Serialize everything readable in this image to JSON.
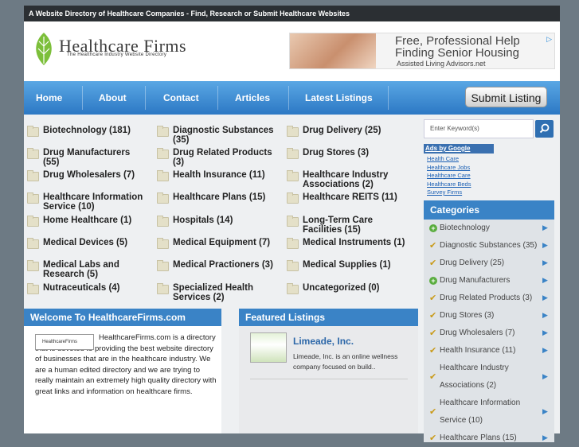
{
  "topbar": {
    "text": "A Website Directory of Healthcare Companies - Find, Research or Submit Healthcare Websites"
  },
  "logo": {
    "title": "Healthcare Firms",
    "tagline": "The Healthcare Industry Website Directory"
  },
  "ad": {
    "line1": "Free, Professional Help",
    "line2": "Finding Senior Housing",
    "source": "Assisted Living Advisors.net"
  },
  "nav": {
    "items": [
      "Home",
      "About",
      "Contact",
      "Articles",
      "Latest Listings"
    ],
    "submit": "Submit Listing"
  },
  "categories": [
    [
      "Biotechnology (181)",
      "Diagnostic Substances (35)",
      "Drug Delivery (25)"
    ],
    [
      "Drug Manufacturers (55)",
      "Drug Related Products (3)",
      "Drug Stores (3)"
    ],
    [
      "Drug Wholesalers (7)",
      "Health Insurance (11)",
      "Healthcare Industry Associations (2)"
    ],
    [
      "Healthcare Information Service (10)",
      "Healthcare Plans (15)",
      "Healthcare REITS (11)"
    ],
    [
      "Home Healthcare (1)",
      "Hospitals (14)",
      "Long-Term Care Facilities (15)"
    ],
    [
      "Medical Devices (5)",
      "Medical Equipment (7)",
      "Medical Instruments (1)"
    ],
    [
      "Medical Labs and Research (5)",
      "Medical Practioners (3)",
      "Medical Supplies (1)"
    ],
    [
      "Nutraceuticals (4)",
      "Specialized Health Services (2)",
      "Uncategorized (0)"
    ]
  ],
  "welcome": {
    "heading": "Welcome To HealthcareFirms.com",
    "logo_text": "HealthcareFirms",
    "text": "HealthcareFirms.com is a directory that is devoted to providing the best website directory of businesses that are in the healthcare industry. We are a human edited directory and we are trying to really maintain an extremely high quality directory with great links and information on healthcare firms."
  },
  "featured": {
    "heading": "Featured Listings",
    "title": "Limeade, Inc.",
    "desc": "Limeade, Inc. is an online wellness company focused on build.."
  },
  "search": {
    "placeholder": "Enter Keyword(s)"
  },
  "ads_google": {
    "label": "Ads by Google",
    "links": [
      "Health Care",
      "Healthcare Jobs",
      "Healthcare Care",
      "Healthcare Beds",
      "Survey Firms"
    ]
  },
  "sidebar": {
    "heading": "Categories",
    "items": [
      {
        "label": "Biotechnology",
        "icon": "plus"
      },
      {
        "label": "Diagnostic Substances (35)",
        "icon": "check"
      },
      {
        "label": "Drug Delivery (25)",
        "icon": "check"
      },
      {
        "label": "Drug Manufacturers",
        "icon": "plus"
      },
      {
        "label": "Drug Related Products (3)",
        "icon": "check"
      },
      {
        "label": "Drug Stores (3)",
        "icon": "check"
      },
      {
        "label": "Drug Wholesalers (7)",
        "icon": "check"
      },
      {
        "label": "Health Insurance (11)",
        "icon": "check"
      },
      {
        "label": "Healthcare Industry Associations (2)",
        "icon": "check"
      },
      {
        "label": "Healthcare Information Service (10)",
        "icon": "check"
      },
      {
        "label": "Healthcare Plans (15)",
        "icon": "check"
      }
    ]
  },
  "colors": {
    "accent": "#3a83c6",
    "nav": "#2c78c4",
    "background": "#6d7a84"
  }
}
